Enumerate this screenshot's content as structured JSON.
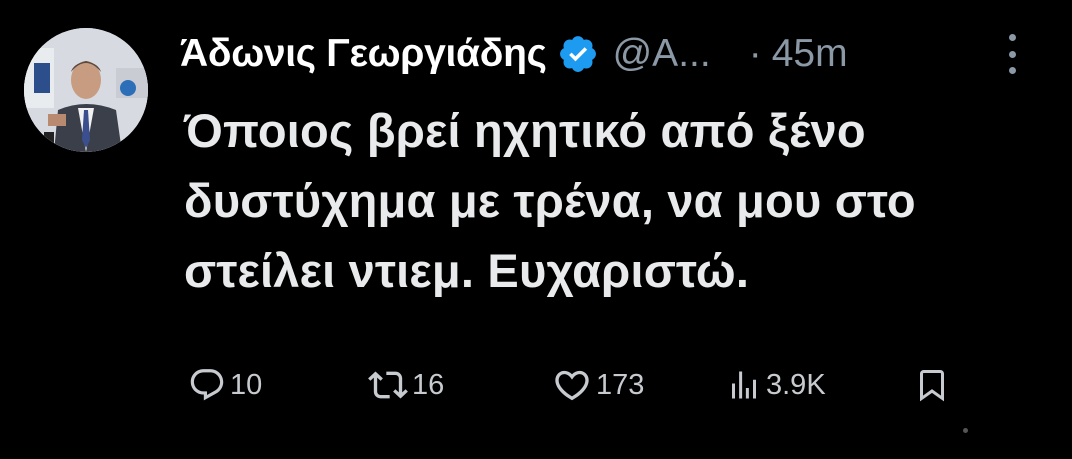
{
  "tweet": {
    "author": {
      "display_name": "Άδωνις Γεωργιάδης",
      "handle": "@A...",
      "verified_icon": "verified-badge-icon",
      "avatar": "avatar-image"
    },
    "separator": "·",
    "time": "45m",
    "text_lines": [
      "Όποιος βρεί ηχητικό από ξένο",
      "δυστύχημα με τρένα, να μου στο",
      "στείλει ντιεμ. Ευχαριστώ."
    ],
    "actions": {
      "reply": {
        "icon": "reply-icon",
        "count": "10"
      },
      "retweet": {
        "icon": "retweet-icon",
        "count": "16"
      },
      "like": {
        "icon": "like-icon",
        "count": "173"
      },
      "views": {
        "icon": "views-icon",
        "count": "3.9K"
      },
      "bookmark": {
        "icon": "bookmark-icon"
      }
    },
    "more_icon": "more-options-icon"
  },
  "colors": {
    "background": "#000000",
    "primary_text": "#e7e9ea",
    "secondary_text": "#8b98a5",
    "verified_blue": "#1d9bf0"
  }
}
